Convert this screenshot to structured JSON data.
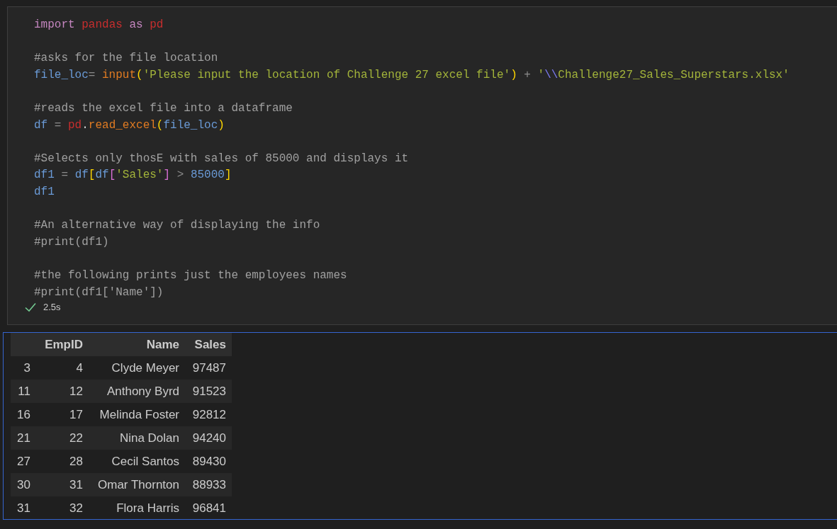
{
  "code_cell": {
    "lines": [
      {
        "kind": "code",
        "tokens": [
          {
            "text": "import ",
            "kind": "keyword"
          },
          {
            "text": "pandas ",
            "kind": "module"
          },
          {
            "text": "as ",
            "kind": "keyword"
          },
          {
            "text": "pd",
            "kind": "module"
          }
        ]
      },
      {
        "kind": "blank"
      },
      {
        "kind": "code",
        "tokens": [
          {
            "text": "#asks for the file location",
            "kind": "comment"
          }
        ]
      },
      {
        "kind": "code",
        "tokens": [
          {
            "text": "file_loc",
            "kind": "variable"
          },
          {
            "text": "= ",
            "kind": "operator"
          },
          {
            "text": "input",
            "kind": "function"
          },
          {
            "text": "(",
            "kind": "bracket1"
          },
          {
            "text": "'Please input the location of Challenge 27 excel file'",
            "kind": "string"
          },
          {
            "text": ")",
            "kind": "bracket1"
          },
          {
            "text": " + ",
            "kind": "operator"
          },
          {
            "text": "'",
            "kind": "string"
          },
          {
            "text": "\\\\",
            "kind": "escape"
          },
          {
            "text": "Challenge27_Sales_Superstars.xlsx'",
            "kind": "string"
          }
        ]
      },
      {
        "kind": "blank"
      },
      {
        "kind": "code",
        "tokens": [
          {
            "text": "#reads the excel file into a dataframe",
            "kind": "comment"
          }
        ]
      },
      {
        "kind": "code",
        "tokens": [
          {
            "text": "df",
            "kind": "variable"
          },
          {
            "text": " = ",
            "kind": "operator"
          },
          {
            "text": "pd",
            "kind": "module"
          },
          {
            "text": ".",
            "kind": "plain"
          },
          {
            "text": "read_excel",
            "kind": "function"
          },
          {
            "text": "(",
            "kind": "bracket1"
          },
          {
            "text": "file_loc",
            "kind": "variable"
          },
          {
            "text": ")",
            "kind": "bracket1"
          }
        ]
      },
      {
        "kind": "blank"
      },
      {
        "kind": "code",
        "tokens": [
          {
            "text": "#Selects only thosE with sales of 85000 and displays it",
            "kind": "comment"
          }
        ]
      },
      {
        "kind": "code",
        "tokens": [
          {
            "text": "df1",
            "kind": "variable"
          },
          {
            "text": " = ",
            "kind": "operator"
          },
          {
            "text": "df",
            "kind": "variable"
          },
          {
            "text": "[",
            "kind": "bracket1"
          },
          {
            "text": "df",
            "kind": "variable"
          },
          {
            "text": "[",
            "kind": "bracket2"
          },
          {
            "text": "'Sales'",
            "kind": "string"
          },
          {
            "text": "]",
            "kind": "bracket2"
          },
          {
            "text": " > ",
            "kind": "operator"
          },
          {
            "text": "85000",
            "kind": "number"
          },
          {
            "text": "]",
            "kind": "bracket1"
          }
        ]
      },
      {
        "kind": "code",
        "tokens": [
          {
            "text": "df1",
            "kind": "variable"
          }
        ]
      },
      {
        "kind": "blank"
      },
      {
        "kind": "code",
        "tokens": [
          {
            "text": "#An alternative way of displaying the info",
            "kind": "comment"
          }
        ]
      },
      {
        "kind": "code",
        "tokens": [
          {
            "text": "#print(df1)",
            "kind": "comment"
          }
        ]
      },
      {
        "kind": "blank"
      },
      {
        "kind": "code",
        "tokens": [
          {
            "text": "#the following prints just the employees names",
            "kind": "comment"
          }
        ]
      },
      {
        "kind": "code",
        "tokens": [
          {
            "text": "#print(df1['Name'])",
            "kind": "comment"
          }
        ]
      }
    ],
    "status": {
      "succeeded": true,
      "duration": "2.5s"
    }
  },
  "output": {
    "table": {
      "columns": [
        "EmpID",
        "Name",
        "Sales"
      ],
      "rows": [
        {
          "index": "3",
          "cells": [
            "4",
            "Clyde Meyer",
            "97487"
          ]
        },
        {
          "index": "11",
          "cells": [
            "12",
            "Anthony Byrd",
            "91523"
          ]
        },
        {
          "index": "16",
          "cells": [
            "17",
            "Melinda Foster",
            "92812"
          ]
        },
        {
          "index": "21",
          "cells": [
            "22",
            "Nina Dolan",
            "94240"
          ]
        },
        {
          "index": "27",
          "cells": [
            "28",
            "Cecil Santos",
            "89430"
          ]
        },
        {
          "index": "30",
          "cells": [
            "31",
            "Omar Thornton",
            "88933"
          ]
        },
        {
          "index": "31",
          "cells": [
            "32",
            "Flora Harris",
            "96841"
          ]
        }
      ]
    }
  }
}
